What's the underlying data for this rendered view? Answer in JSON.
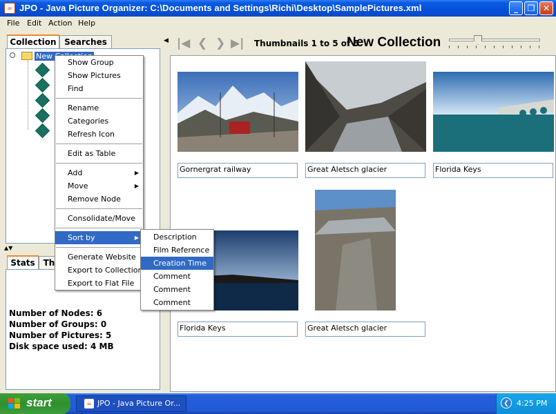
{
  "window": {
    "title": "JPO - Java Picture Organizer:  C:\\Documents and Settings\\Richi\\Desktop\\SamplePictures.xml"
  },
  "menubar": [
    "File",
    "Edit",
    "Action",
    "Help"
  ],
  "left": {
    "tabs_top": [
      "Collection",
      "Searches"
    ],
    "tree_root": "New Collection",
    "tabs_bottom": [
      "Stats",
      "Th"
    ],
    "stats": [
      "Number of Nodes: 6",
      "Number of Groups: 0",
      "Number of Pictures: 5",
      "Disk space used: 4 MB"
    ]
  },
  "navbar": {
    "count": "Thumbnails 1 to 5 of 5",
    "title": "New Collection",
    "slider_level": 0.32
  },
  "thumbnails": [
    {
      "caption": "Gornergrat railway"
    },
    {
      "caption": "Great Aletsch glacier"
    },
    {
      "caption": "Florida Keys"
    },
    {
      "caption": "Florida Keys"
    },
    {
      "caption": "Great Aletsch glacier"
    }
  ],
  "context_menu": {
    "groups": [
      [
        "Show Group",
        "Show Pictures",
        "Find"
      ],
      [
        "Rename",
        "Categories",
        "Refresh Icon"
      ],
      [
        "Edit as Table"
      ],
      [
        "Add",
        "Move",
        "Remove Node"
      ],
      [
        "Consolidate/Move"
      ],
      [
        "Sort by"
      ],
      [
        "Generate Website",
        "Export to Collection",
        "Export to Flat File"
      ]
    ]
  },
  "submenu": {
    "items": [
      "Description",
      "Film Reference",
      "Creation Time",
      "Comment",
      "Comment",
      "Comment"
    ],
    "selected": "Creation Time"
  },
  "taskbar": {
    "start": "start",
    "task": "JPO - Java Picture Or...",
    "clock": "4:25 PM"
  }
}
